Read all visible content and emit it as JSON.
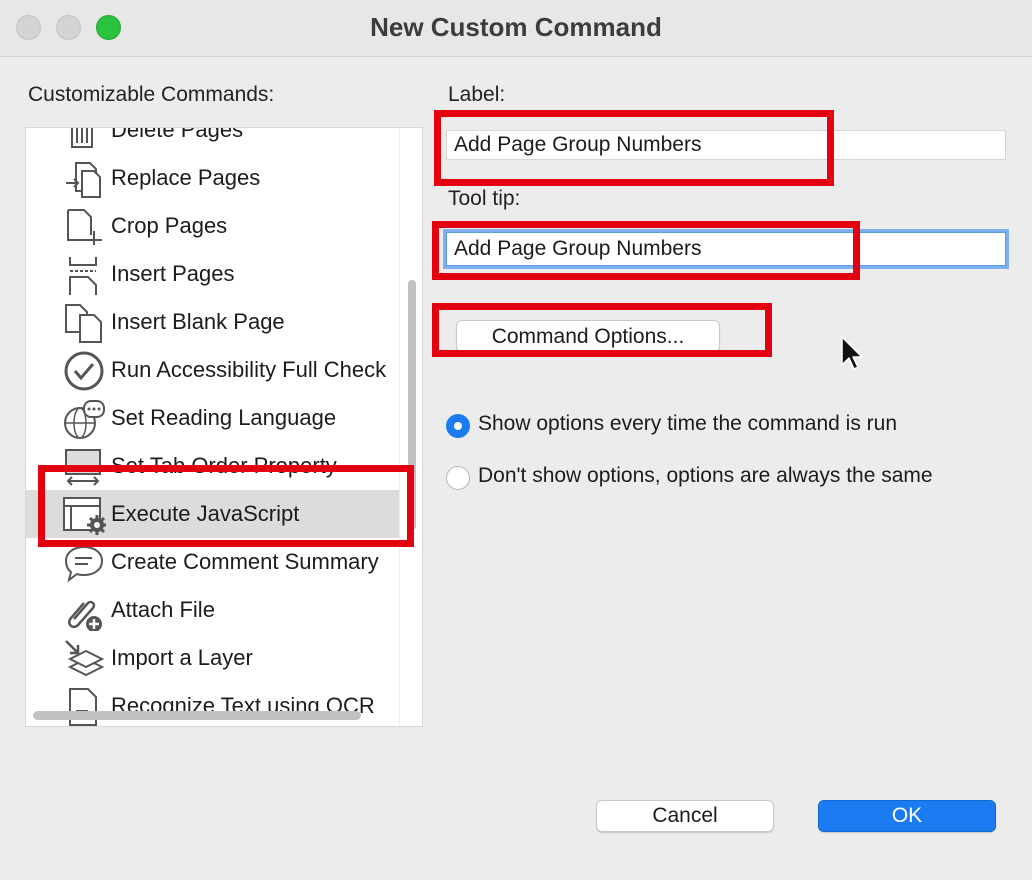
{
  "window": {
    "title": "New Custom Command"
  },
  "left": {
    "heading": "Customizable Commands:",
    "items": [
      {
        "label": "Delete Pages",
        "icon": "delete-pages-icon"
      },
      {
        "label": "Replace Pages",
        "icon": "replace-pages-icon"
      },
      {
        "label": "Crop Pages",
        "icon": "crop-pages-icon"
      },
      {
        "label": "Insert Pages",
        "icon": "insert-pages-icon"
      },
      {
        "label": "Insert Blank Page",
        "icon": "insert-blank-page-icon"
      },
      {
        "label": "Run Accessibility Full Check",
        "icon": "accessibility-check-icon"
      },
      {
        "label": "Set Reading Language",
        "icon": "reading-language-icon"
      },
      {
        "label": "Set Tab Order Property",
        "icon": "tab-order-icon"
      },
      {
        "label": "Execute JavaScript",
        "icon": "javascript-gear-icon",
        "selected": true
      },
      {
        "label": "Create Comment Summary",
        "icon": "comment-summary-icon"
      },
      {
        "label": "Attach File",
        "icon": "attach-file-icon"
      },
      {
        "label": "Import a Layer",
        "icon": "import-layer-icon"
      },
      {
        "label": "Recognize Text using OCR",
        "icon": "ocr-icon"
      }
    ]
  },
  "form": {
    "label_heading": "Label:",
    "label_value": "Add Page Group Numbers",
    "tooltip_heading": "Tool tip:",
    "tooltip_value": "Add Page Group Numbers",
    "command_options_button": "Command Options...",
    "radio_show": "Show options every time the command is run",
    "radio_dont_show": "Don't show options, options are always the same",
    "selected_radio": "show"
  },
  "footer": {
    "cancel": "Cancel",
    "ok": "OK"
  },
  "colors": {
    "accent": "#1a7cf0",
    "highlight": "#e3000f",
    "zoom": "#2ac33f"
  }
}
